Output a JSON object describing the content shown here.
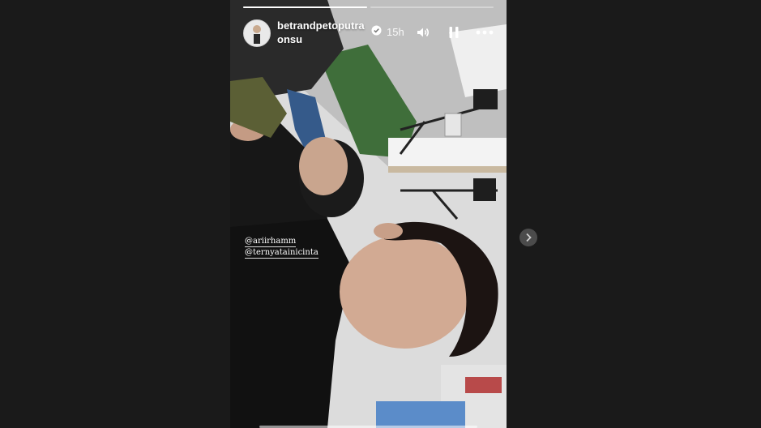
{
  "story": {
    "username": "betrandpetoputraonsu",
    "time_ago": "15h",
    "progress": [
      1.0,
      0.0
    ],
    "mentions": [
      "@ariirhamm",
      "@ternyatainicinta"
    ]
  },
  "icons": {
    "verified": "verified-badge-icon",
    "sound": "speaker-icon",
    "pause": "pause-icon",
    "more": "more-icon",
    "next": "chevron-right-icon"
  },
  "colors": {
    "page_background": "#1a1a1a",
    "text": "#ffffff",
    "next_button": "#4b4b4b"
  }
}
